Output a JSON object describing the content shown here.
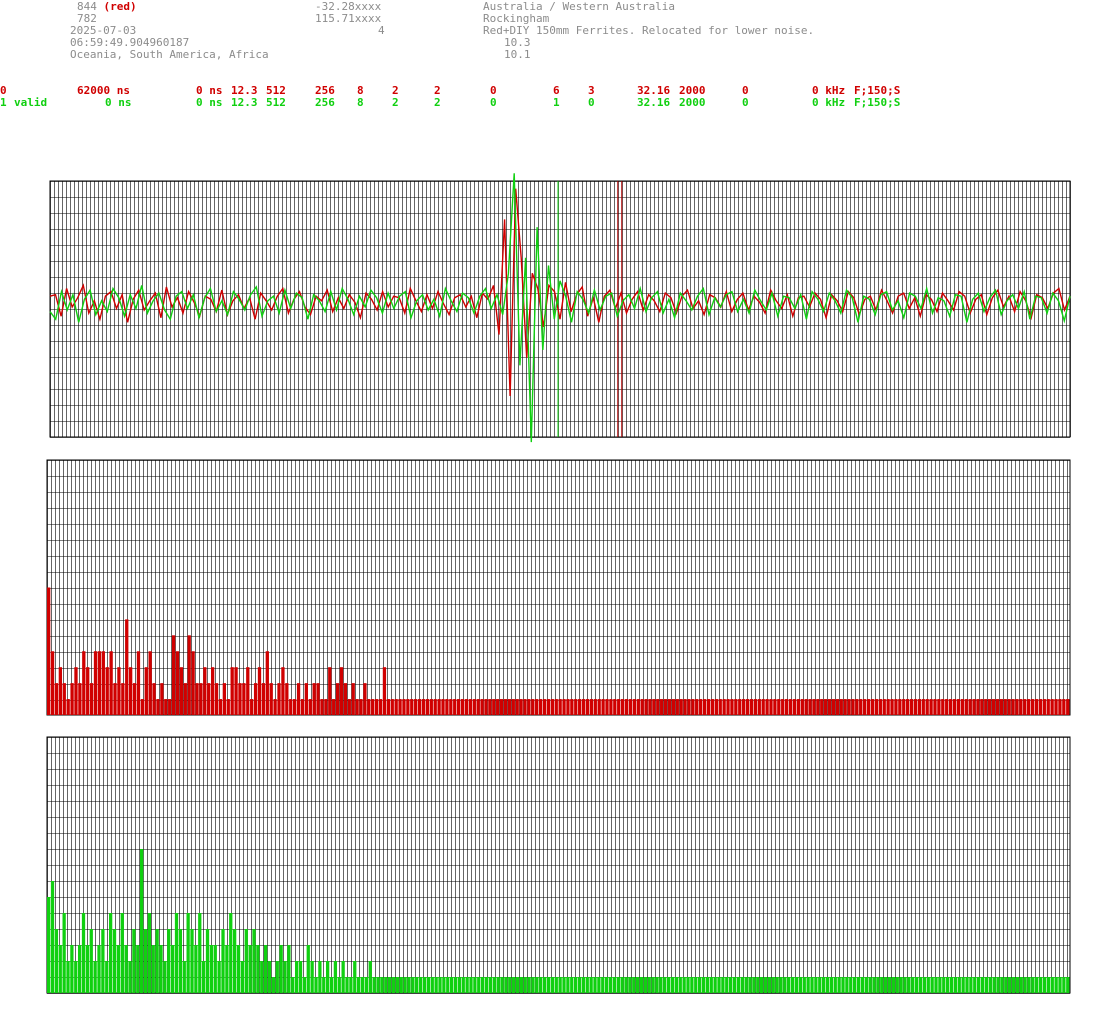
{
  "header": {
    "station_id": "844",
    "station_color_label": "(red)",
    "second_line_num": "782",
    "date": "2025-07-03",
    "time": "06:59:49.904960187",
    "regions": "Oceania, South America, Africa",
    "latitude": "-32.28xxxx",
    "longitude": "115.71xxxx",
    "count": "4",
    "country": "Australia / Western Australia",
    "city": "Rockingham",
    "description": "Red+DIY 150mm Ferrites. Relocated for lower noise.",
    "val1": "10.3",
    "val2": "10.1"
  },
  "channels": [
    {
      "id": "0",
      "status": "",
      "delay": "62000 ns",
      "offset": "0 ns",
      "v1": "12.3",
      "v2": "512",
      "v3": "256",
      "v4": "8",
      "v5": "2",
      "v6": "2",
      "v7": "0",
      "v8": "6",
      "v9": "3",
      "v10": "32.16",
      "v11": "2000",
      "v12": "0",
      "freq": "0 kHz",
      "filter": "F;150;S",
      "color": "#d00000"
    },
    {
      "id": "1",
      "status": "valid",
      "delay": "0 ns",
      "offset": "0 ns",
      "v1": "12.3",
      "v2": "512",
      "v3": "256",
      "v4": "8",
      "v5": "2",
      "v6": "2",
      "v7": "0",
      "v8": "1",
      "v9": "0",
      "v10": "32.16",
      "v11": "2000",
      "v12": "0",
      "freq": "0 kHz",
      "filter": "F;150;S",
      "color": "#10d010"
    }
  ],
  "chart_data": [
    {
      "type": "line",
      "panel": "waveform",
      "xlim": [
        0,
        512
      ],
      "ylim": [
        -1,
        1
      ],
      "grid": true,
      "markers": [
        255,
        285,
        287
      ],
      "series": [
        {
          "color": "#d00000",
          "values": [
            0.05,
            0.06,
            -0.08,
            0.1,
            -0.02,
            0.04,
            0.12,
            -0.06,
            0.02,
            -0.1,
            0.05,
            0.08,
            -0.03,
            0.06,
            -0.12,
            0.03,
            0.09,
            -0.04,
            0.02,
            0.07,
            -0.09,
            0.11,
            -0.02,
            0.04,
            -0.06,
            0.08,
            0.01,
            -0.08,
            0.05,
            0.03,
            -0.05,
            0.09,
            -0.07,
            0.02,
            0.06,
            -0.03,
            0.04,
            -0.1,
            0.07,
            0.02,
            -0.04,
            0.05,
            0.1,
            -0.06,
            0.03,
            0.08,
            -0.02,
            -0.07,
            0.05,
            0.02,
            0.09,
            -0.05,
            0.04,
            -0.03,
            0.06,
            0.01,
            -0.09,
            0.07,
            0.03,
            -0.04,
            0.08,
            -0.02,
            0.05,
            0.04,
            -0.06,
            0.1,
            0.02,
            -0.05,
            0.06,
            -0.03,
            0.08,
            0.0,
            -0.07,
            0.04,
            0.06,
            -0.02,
            0.05,
            -0.09,
            0.07,
            0.03,
            0.12,
            -0.2,
            0.55,
            -0.6,
            0.75,
            0.3,
            -0.35,
            0.2,
            0.1,
            -0.15,
            0.12,
            0.08,
            -0.1,
            0.14,
            -0.05,
            0.06,
            0.11,
            -0.08,
            0.04,
            -0.12,
            0.05,
            0.09,
            -0.03,
            0.07,
            -0.06,
            0.03,
            0.08,
            -0.04,
            0.06,
            0.02,
            -0.05,
            0.07,
            0.04,
            -0.06,
            0.05,
            0.09,
            -0.03,
            0.02,
            -0.07,
            0.06,
            0.04,
            -0.02,
            0.08,
            -0.05,
            0.03,
            0.07,
            -0.04,
            0.05,
            0.01,
            -0.06,
            0.09,
            0.02,
            -0.03,
            0.06,
            -0.08,
            0.04,
            0.05,
            -0.02,
            0.07,
            0.03,
            -0.09,
            0.06,
            0.02,
            -0.05,
            0.08,
            0.04,
            -0.07,
            0.03,
            0.05,
            -0.04,
            0.09,
            0.02,
            -0.06,
            0.05,
            0.07,
            -0.03,
            0.04,
            -0.08,
            0.06,
            0.03,
            -0.05,
            0.07,
            0.02,
            -0.04,
            0.08,
            0.05,
            -0.06,
            0.03,
            0.06,
            -0.07,
            0.04,
            0.09,
            -0.02,
            0.05,
            -0.05,
            0.08,
            0.02,
            -0.09,
            0.06,
            0.04,
            -0.03,
            0.07,
            0.1,
            -0.04,
            0.05
          ]
        },
        {
          "color": "#10d010",
          "values": [
            -0.05,
            -0.1,
            0.08,
            -0.04,
            0.06,
            -0.12,
            0.03,
            0.09,
            -0.07,
            0.02,
            -0.05,
            0.1,
            0.04,
            -0.08,
            0.06,
            -0.03,
            0.12,
            -0.06,
            0.02,
            0.07,
            -0.04,
            -0.1,
            0.05,
            0.08,
            -0.03,
            0.06,
            -0.09,
            0.04,
            0.1,
            -0.05,
            0.02,
            -0.07,
            0.08,
            0.03,
            -0.04,
            0.06,
            0.11,
            -0.08,
            0.02,
            0.05,
            -0.06,
            0.09,
            -0.03,
            0.07,
            0.04,
            -0.1,
            0.06,
            0.02,
            -0.05,
            0.08,
            -0.04,
            0.1,
            0.03,
            -0.07,
            0.05,
            -0.02,
            0.09,
            0.04,
            -0.06,
            0.07,
            -0.03,
            0.05,
            0.08,
            -0.09,
            0.02,
            0.06,
            -0.04,
            0.03,
            -0.08,
            0.1,
            0.02,
            -0.05,
            0.07,
            0.04,
            -0.06,
            0.05,
            0.1,
            -0.03,
            0.06,
            -0.07,
            0.2,
            0.85,
            -0.4,
            0.3,
            -0.9,
            0.5,
            -0.3,
            0.25,
            -0.1,
            0.15,
            0.05,
            -0.12,
            0.08,
            0.03,
            -0.06,
            0.09,
            -0.04,
            0.05,
            0.07,
            -0.08,
            0.02,
            0.06,
            -0.03,
            0.1,
            -0.05,
            0.04,
            0.08,
            -0.06,
            0.03,
            -0.09,
            0.07,
            0.02,
            -0.04,
            0.05,
            0.1,
            -0.07,
            0.04,
            -0.02,
            0.06,
            0.08,
            -0.05,
            0.03,
            -0.06,
            0.09,
            0.02,
            -0.04,
            0.07,
            -0.08,
            0.05,
            0.04,
            -0.03,
            0.06,
            -0.1,
            0.08,
            0.03,
            -0.05,
            0.07,
            0.02,
            -0.06,
            0.09,
            0.04,
            -0.12,
            0.05,
            0.03,
            -0.07,
            0.06,
            0.08,
            -0.04,
            0.02,
            -0.09,
            0.07,
            0.05,
            -0.03,
            0.1,
            -0.06,
            0.04,
            0.02,
            -0.08,
            0.06,
            0.05,
            -0.12,
            0.03,
            0.07,
            -0.05,
            0.04,
            0.09,
            -0.07,
            0.02,
            0.06,
            -0.03,
            0.08,
            -0.1,
            0.05,
            0.04,
            -0.06,
            0.07,
            0.02,
            -0.11,
            0.05
          ]
        }
      ]
    },
    {
      "type": "bar",
      "panel": "spectrum-red",
      "ylim": [
        0,
        16
      ],
      "color": "#d00000",
      "values": [
        8,
        4,
        2,
        3,
        2,
        1,
        2,
        3,
        2,
        4,
        3,
        2,
        4,
        4,
        4,
        3,
        4,
        2,
        3,
        2,
        6,
        3,
        2,
        4,
        1,
        3,
        4,
        2,
        1,
        2,
        1,
        1,
        5,
        4,
        3,
        2,
        5,
        4,
        2,
        2,
        3,
        2,
        3,
        2,
        1,
        2,
        1,
        3,
        3,
        2,
        2,
        3,
        1,
        2,
        3,
        2,
        4,
        2,
        1,
        2,
        3,
        2,
        1,
        1,
        2,
        1,
        2,
        1,
        2,
        2,
        1,
        1,
        3,
        1,
        2,
        3,
        2,
        1,
        2,
        1,
        1,
        2,
        1,
        1,
        1,
        1,
        3,
        1,
        1,
        1,
        1,
        1,
        1,
        1,
        1,
        1,
        1,
        1,
        1,
        1,
        1,
        1,
        1,
        1,
        1,
        1,
        1,
        1,
        1,
        1,
        1,
        1,
        1,
        1,
        1,
        1,
        1,
        1,
        1,
        1,
        1,
        1,
        1,
        1,
        1,
        1,
        1,
        1,
        1,
        1,
        1,
        1,
        1,
        1,
        1,
        1,
        1,
        1,
        1,
        1,
        1,
        1,
        1,
        1,
        1,
        1,
        1,
        1,
        1,
        1,
        1,
        1,
        1,
        1,
        1,
        1,
        1,
        1,
        1,
        1,
        1,
        1,
        1,
        1,
        1,
        1,
        1,
        1,
        1,
        1,
        1,
        1,
        1,
        1,
        1,
        1,
        1,
        1,
        1,
        1,
        1,
        1,
        1,
        1,
        1,
        1,
        1,
        1,
        1,
        1,
        1,
        1,
        1,
        1,
        1,
        1,
        1,
        1,
        1,
        1,
        1,
        1,
        1,
        1,
        1,
        1,
        1,
        1,
        1,
        1,
        1,
        1,
        1,
        1,
        1,
        1,
        1,
        1,
        1,
        1,
        1,
        1,
        1,
        1,
        1,
        1,
        1,
        1,
        1,
        1,
        1,
        1,
        1,
        1,
        1,
        1,
        1,
        1,
        1,
        1,
        1,
        1,
        1,
        1,
        1,
        1,
        1,
        1,
        1,
        1,
        1,
        1,
        1,
        1,
        1,
        1,
        1,
        1,
        1,
        1,
        1,
        1
      ]
    },
    {
      "type": "bar",
      "panel": "spectrum-green",
      "ylim": [
        0,
        16
      ],
      "color": "#10d010",
      "values": [
        6,
        7,
        4,
        3,
        5,
        2,
        3,
        2,
        3,
        5,
        3,
        4,
        2,
        3,
        4,
        2,
        5,
        4,
        3,
        5,
        3,
        2,
        4,
        3,
        9,
        4,
        5,
        3,
        4,
        3,
        2,
        4,
        3,
        5,
        4,
        2,
        5,
        4,
        3,
        5,
        2,
        4,
        3,
        3,
        2,
        4,
        3,
        5,
        4,
        3,
        2,
        4,
        3,
        4,
        3,
        2,
        3,
        2,
        1,
        2,
        3,
        2,
        3,
        1,
        2,
        2,
        1,
        3,
        2,
        1,
        2,
        1,
        2,
        1,
        2,
        1,
        2,
        1,
        1,
        2,
        1,
        1,
        1,
        2,
        1,
        1,
        1,
        1,
        1,
        1,
        1,
        1,
        1,
        1,
        1,
        1,
        1,
        1,
        1,
        1,
        1,
        1,
        1,
        1,
        1,
        1,
        1,
        1,
        1,
        1,
        1,
        1,
        1,
        1,
        1,
        1,
        1,
        1,
        1,
        1,
        1,
        1,
        1,
        1,
        1,
        1,
        1,
        1,
        1,
        1,
        1,
        1,
        1,
        1,
        1,
        1,
        1,
        1,
        1,
        1,
        1,
        1,
        1,
        1,
        1,
        1,
        1,
        1,
        1,
        1,
        1,
        1,
        1,
        1,
        1,
        1,
        1,
        1,
        1,
        1,
        1,
        1,
        1,
        1,
        1,
        1,
        1,
        1,
        1,
        1,
        1,
        1,
        1,
        1,
        1,
        1,
        1,
        1,
        1,
        1,
        1,
        1,
        1,
        1,
        1,
        1,
        1,
        1,
        1,
        1,
        1,
        1,
        1,
        1,
        1,
        1,
        1,
        1,
        1,
        1,
        1,
        1,
        1,
        1,
        1,
        1,
        1,
        1,
        1,
        1,
        1,
        1,
        1,
        1,
        1,
        1,
        1,
        1,
        1,
        1,
        1,
        1,
        1,
        1,
        1,
        1,
        1,
        1,
        1,
        1,
        1,
        1,
        1,
        1,
        1,
        1,
        1,
        1,
        1,
        1,
        1,
        1,
        1,
        1,
        1,
        1,
        1,
        1,
        1,
        1,
        1,
        1,
        1,
        1,
        1,
        1,
        1,
        1,
        1,
        1,
        1,
        1,
        1,
        1
      ]
    }
  ]
}
